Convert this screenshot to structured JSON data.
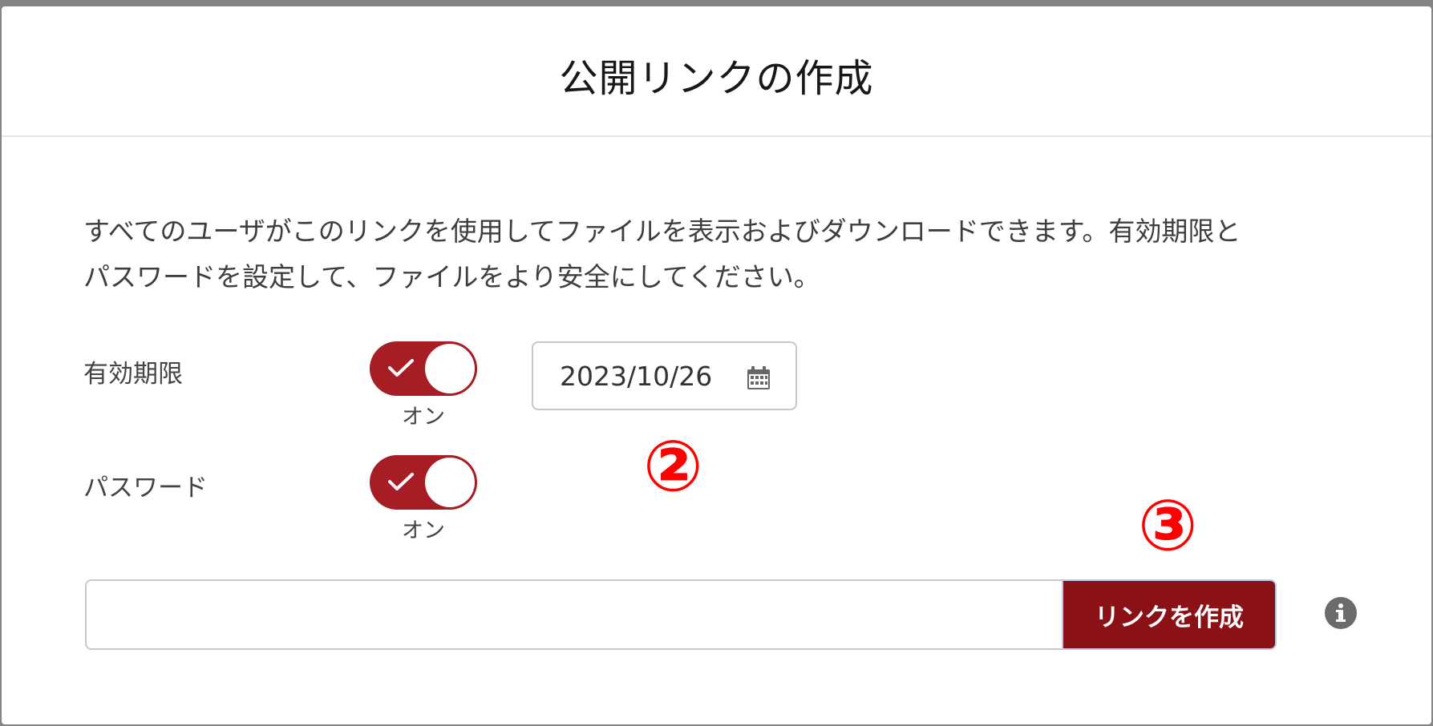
{
  "modal": {
    "title": "公開リンクの作成",
    "description_line1": "すべてのユーザがこのリンクを使用してファイルを表示およびダウンロードできます。有効期限と",
    "description_line2": "パスワードを設定して、ファイルをより安全にしてください。"
  },
  "expiry": {
    "label": "有効期限",
    "toggle_state": "オン",
    "toggle_on": true,
    "date_value": "2023/10/26"
  },
  "password": {
    "label": "パスワード",
    "toggle_state": "オン",
    "toggle_on": true
  },
  "link": {
    "value": "",
    "create_button_label": "リンクを作成"
  },
  "annotations": {
    "step2": "②",
    "step3": "③"
  },
  "colors": {
    "accent": "#a61d24",
    "button": "#8a1217",
    "annotation": "#ff0000"
  },
  "icons": {
    "date": "calendar-icon",
    "info": "info-icon",
    "toggle": "check-icon"
  }
}
